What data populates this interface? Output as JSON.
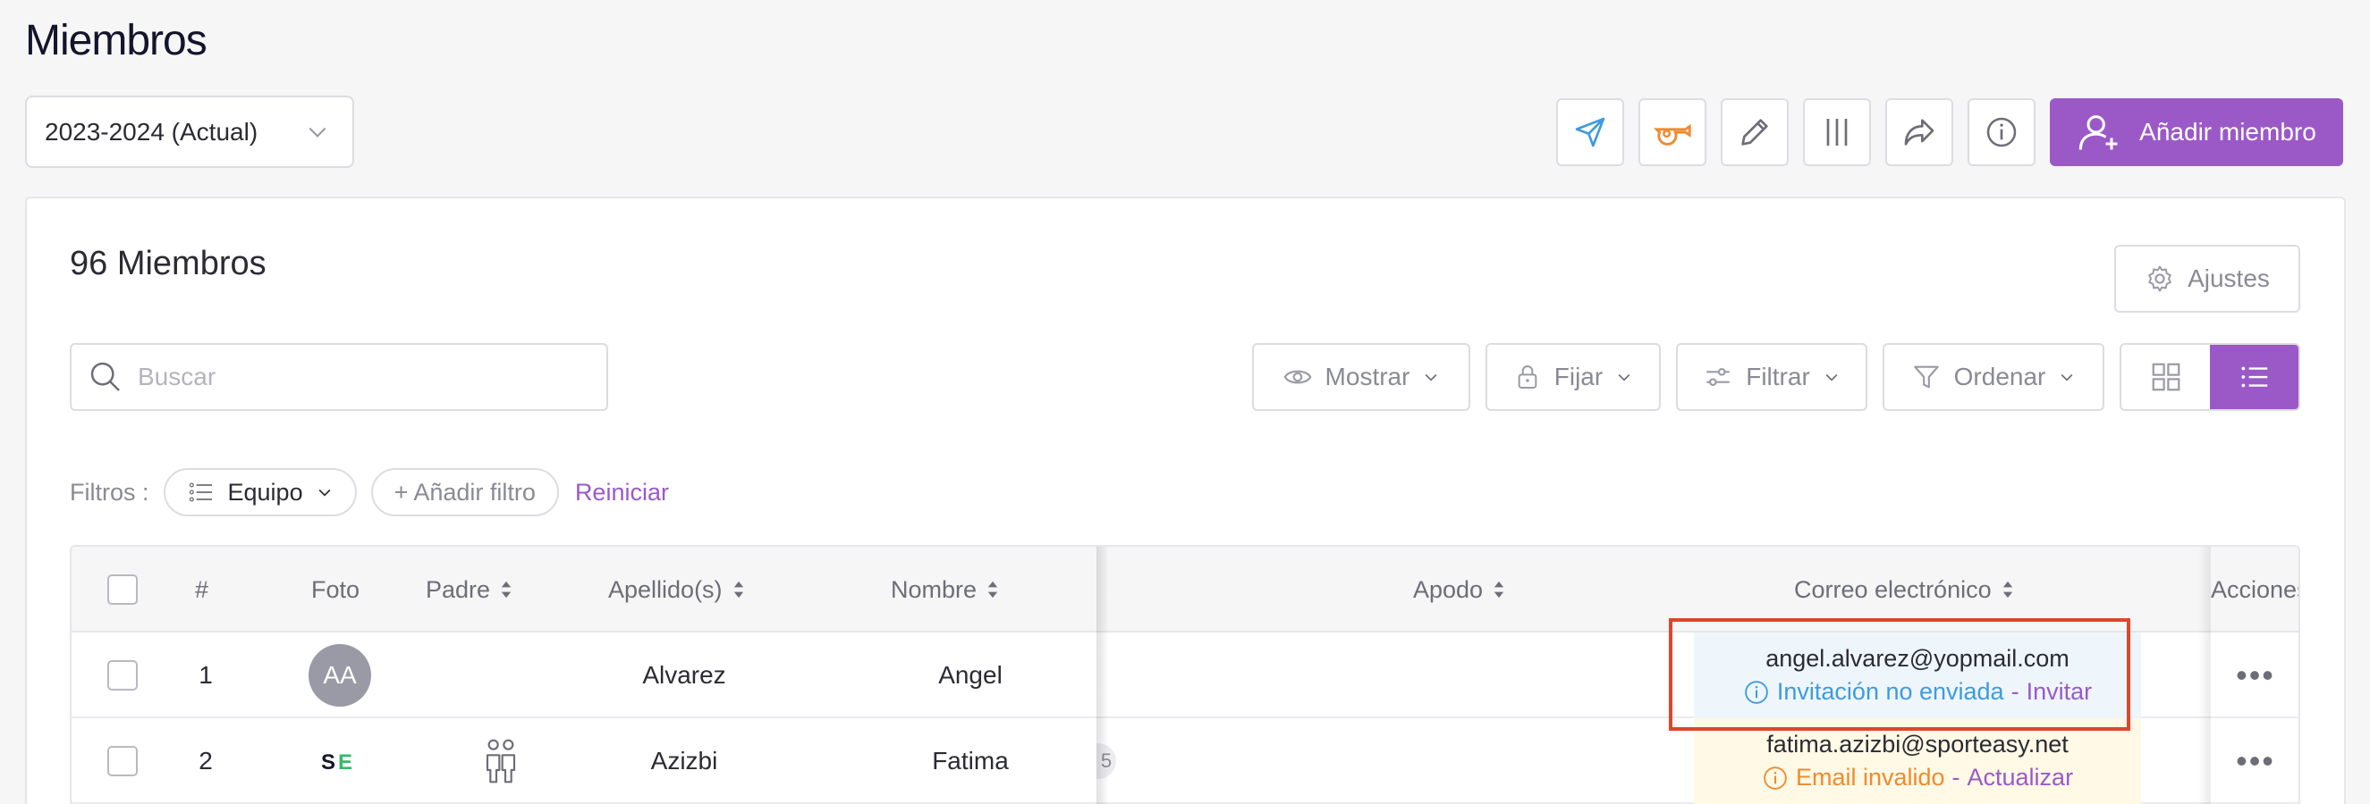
{
  "page": {
    "title": "Miembros"
  },
  "season_select": {
    "value": "2023-2024 (Actual)"
  },
  "toolbar": {
    "icons": [
      "send-icon",
      "whistle-icon",
      "edit-icon",
      "columns-icon",
      "share-icon",
      "info-icon"
    ],
    "add_member_label": "Añadir miembro"
  },
  "card": {
    "count_title": "96 Miembros",
    "settings_label": "Ajustes",
    "search_placeholder": "Buscar",
    "controls": {
      "show": "Mostrar",
      "pin": "Fijar",
      "filter": "Filtrar",
      "sort": "Ordenar"
    },
    "filters": {
      "label": "Filtros :",
      "team": "Equipo",
      "add": "+ Añadir filtro",
      "reset": "Reiniciar"
    }
  },
  "table": {
    "headers": {
      "number": "#",
      "photo": "Foto",
      "parent": "Padre",
      "last_name": "Apellido(s)",
      "first_name": "Nombre",
      "nickname": "Apodo",
      "email": "Correo electrónico",
      "actions": "Acciones"
    },
    "rows": [
      {
        "number": "1",
        "avatar_initials": "AA",
        "last_name": "Alvarez",
        "first_name": "Angel",
        "email": "angel.alvarez@yopmail.com",
        "status": "Invitación no enviada",
        "dash": "-",
        "action": "Invitar"
      },
      {
        "number": "2",
        "avatar_logo": "SE",
        "partial_badge": "5",
        "last_name": "Azizbi",
        "first_name": "Fatima",
        "email": "fatima.azizbi@sporteasy.net",
        "status": "Email invalido",
        "dash": "-",
        "action": "Actualizar"
      }
    ],
    "actions_glyph": "•••"
  },
  "colors": {
    "accent": "#9b59c8",
    "info_blue": "#3d9be0",
    "warn_orange": "#ef8a2f",
    "highlight_red": "#e0452b"
  }
}
